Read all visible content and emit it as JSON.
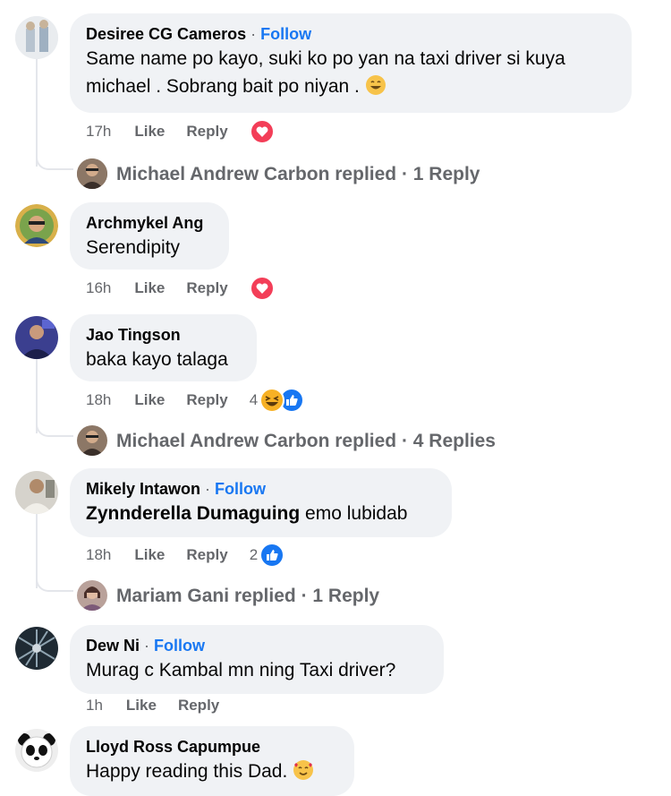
{
  "comments": [
    {
      "author": "Desiree CG Cameros",
      "follow_sep": " · ",
      "follow": "Follow",
      "text_line1": "Same name po kayo, suki ko po yan na taxi driver si kuya",
      "text_line2": "michael . Sobrang bait po niyan .",
      "time": "17h",
      "like": "Like",
      "reply": "Reply",
      "reaction": "love-reaction",
      "replies": {
        "text": "Michael Andrew Carbon replied · 1 Reply"
      }
    },
    {
      "author": "Archmykel Ang",
      "text": "Serendipity",
      "time": "16h",
      "like": "Like",
      "reply": "Reply",
      "reaction": "love-reaction"
    },
    {
      "author": "Jao Tingson",
      "text": "baka kayo talaga",
      "time": "18h",
      "like": "Like",
      "reply": "Reply",
      "reaction_count": "4",
      "reactions": [
        "haha",
        "like"
      ],
      "replies": {
        "text": "Michael Andrew Carbon replied · 4 Replies"
      }
    },
    {
      "author": "Mikely Intawon",
      "follow_sep": " · ",
      "follow": "Follow",
      "mention": "Zynnderella Dumaguing",
      "text": " emo lubidab",
      "time": "18h",
      "like": "Like",
      "reply": "Reply",
      "reaction_count": "2",
      "reactions": [
        "like"
      ],
      "replies": {
        "text": "Mariam Gani replied · 1 Reply"
      }
    },
    {
      "author": "Dew Ni",
      "follow_sep": " · ",
      "follow": "Follow",
      "text": "Murag c Kambal mn ning Taxi driver?",
      "time": "1h",
      "like": "Like",
      "reply": "Reply"
    },
    {
      "author": "Lloyd Ross Capumpue",
      "text": "Happy reading this Dad."
    }
  ],
  "colors": {
    "bubble": "#f0f2f5",
    "meta": "#65676b",
    "link": "#1877f2",
    "love": "#f33e58",
    "like": "#1877f2",
    "haha": "#f7b125"
  }
}
